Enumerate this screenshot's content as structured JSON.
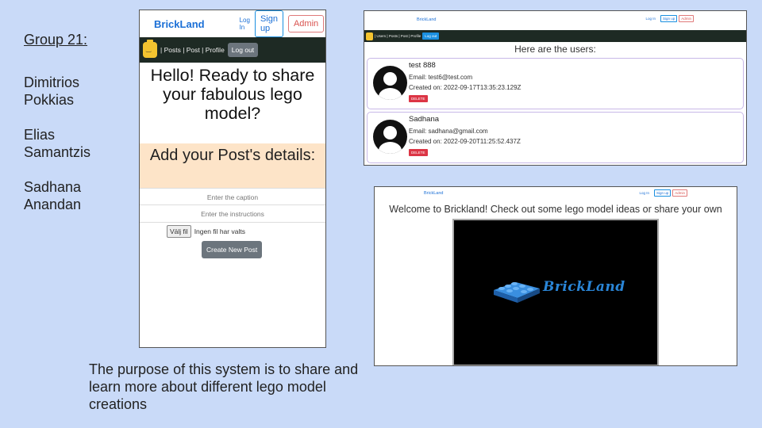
{
  "left_panel": {
    "group_title": "Group 21:",
    "members": [
      "Dimitrios Pokkias",
      "Elias Samantzis",
      "Sadhana Anandan"
    ],
    "purpose": "The purpose of this system is to share and learn more about different lego model creations"
  },
  "screen_post": {
    "brand": "BrickLand",
    "login": "Log In",
    "signup": "Sign up",
    "admin": "Admin",
    "nav_links": "| Posts | Post | Profile",
    "logout": "Log out",
    "hello": "Hello! Ready to share your fabulous lego model?",
    "add_heading": "Add your Post's details:",
    "caption_placeholder": "Enter the caption",
    "instructions_placeholder": "Enter the instructions",
    "file_button": "Välj fil",
    "file_status": "Ingen fil har valts",
    "create_button": "Create New Post"
  },
  "screen_users": {
    "brand": "BrickLand",
    "login": "Log In",
    "signup": "Sign up",
    "admin": "Admin",
    "nav_links": "| Users | Posts | Post | Profile",
    "logout": "Log out",
    "heading": "Here are the users:",
    "users": [
      {
        "name": "test 888",
        "email": "Email: test6@test.com",
        "created": "Created on: 2022-09-17T13:35:23.129Z",
        "delete": "DELETE"
      },
      {
        "name": "Sadhana",
        "email": "Email: sadhana@gmail.com",
        "created": "Created on: 2022-09-20T11:25:52.437Z",
        "delete": "DELETE"
      }
    ]
  },
  "screen_home": {
    "brand": "BrickLand",
    "login": "Log In",
    "signup": "Sign up",
    "admin": "Admin",
    "welcome": "Welcome to Brickland! Check out some lego model ideas or share your own",
    "logo_text": "BrickLand"
  },
  "colors": {
    "background": "#c9daf8",
    "brand_blue": "#1a6fd6",
    "navbar_dark": "#1e2a24",
    "delete_red": "#dc3545",
    "peach": "#fde4c8"
  }
}
